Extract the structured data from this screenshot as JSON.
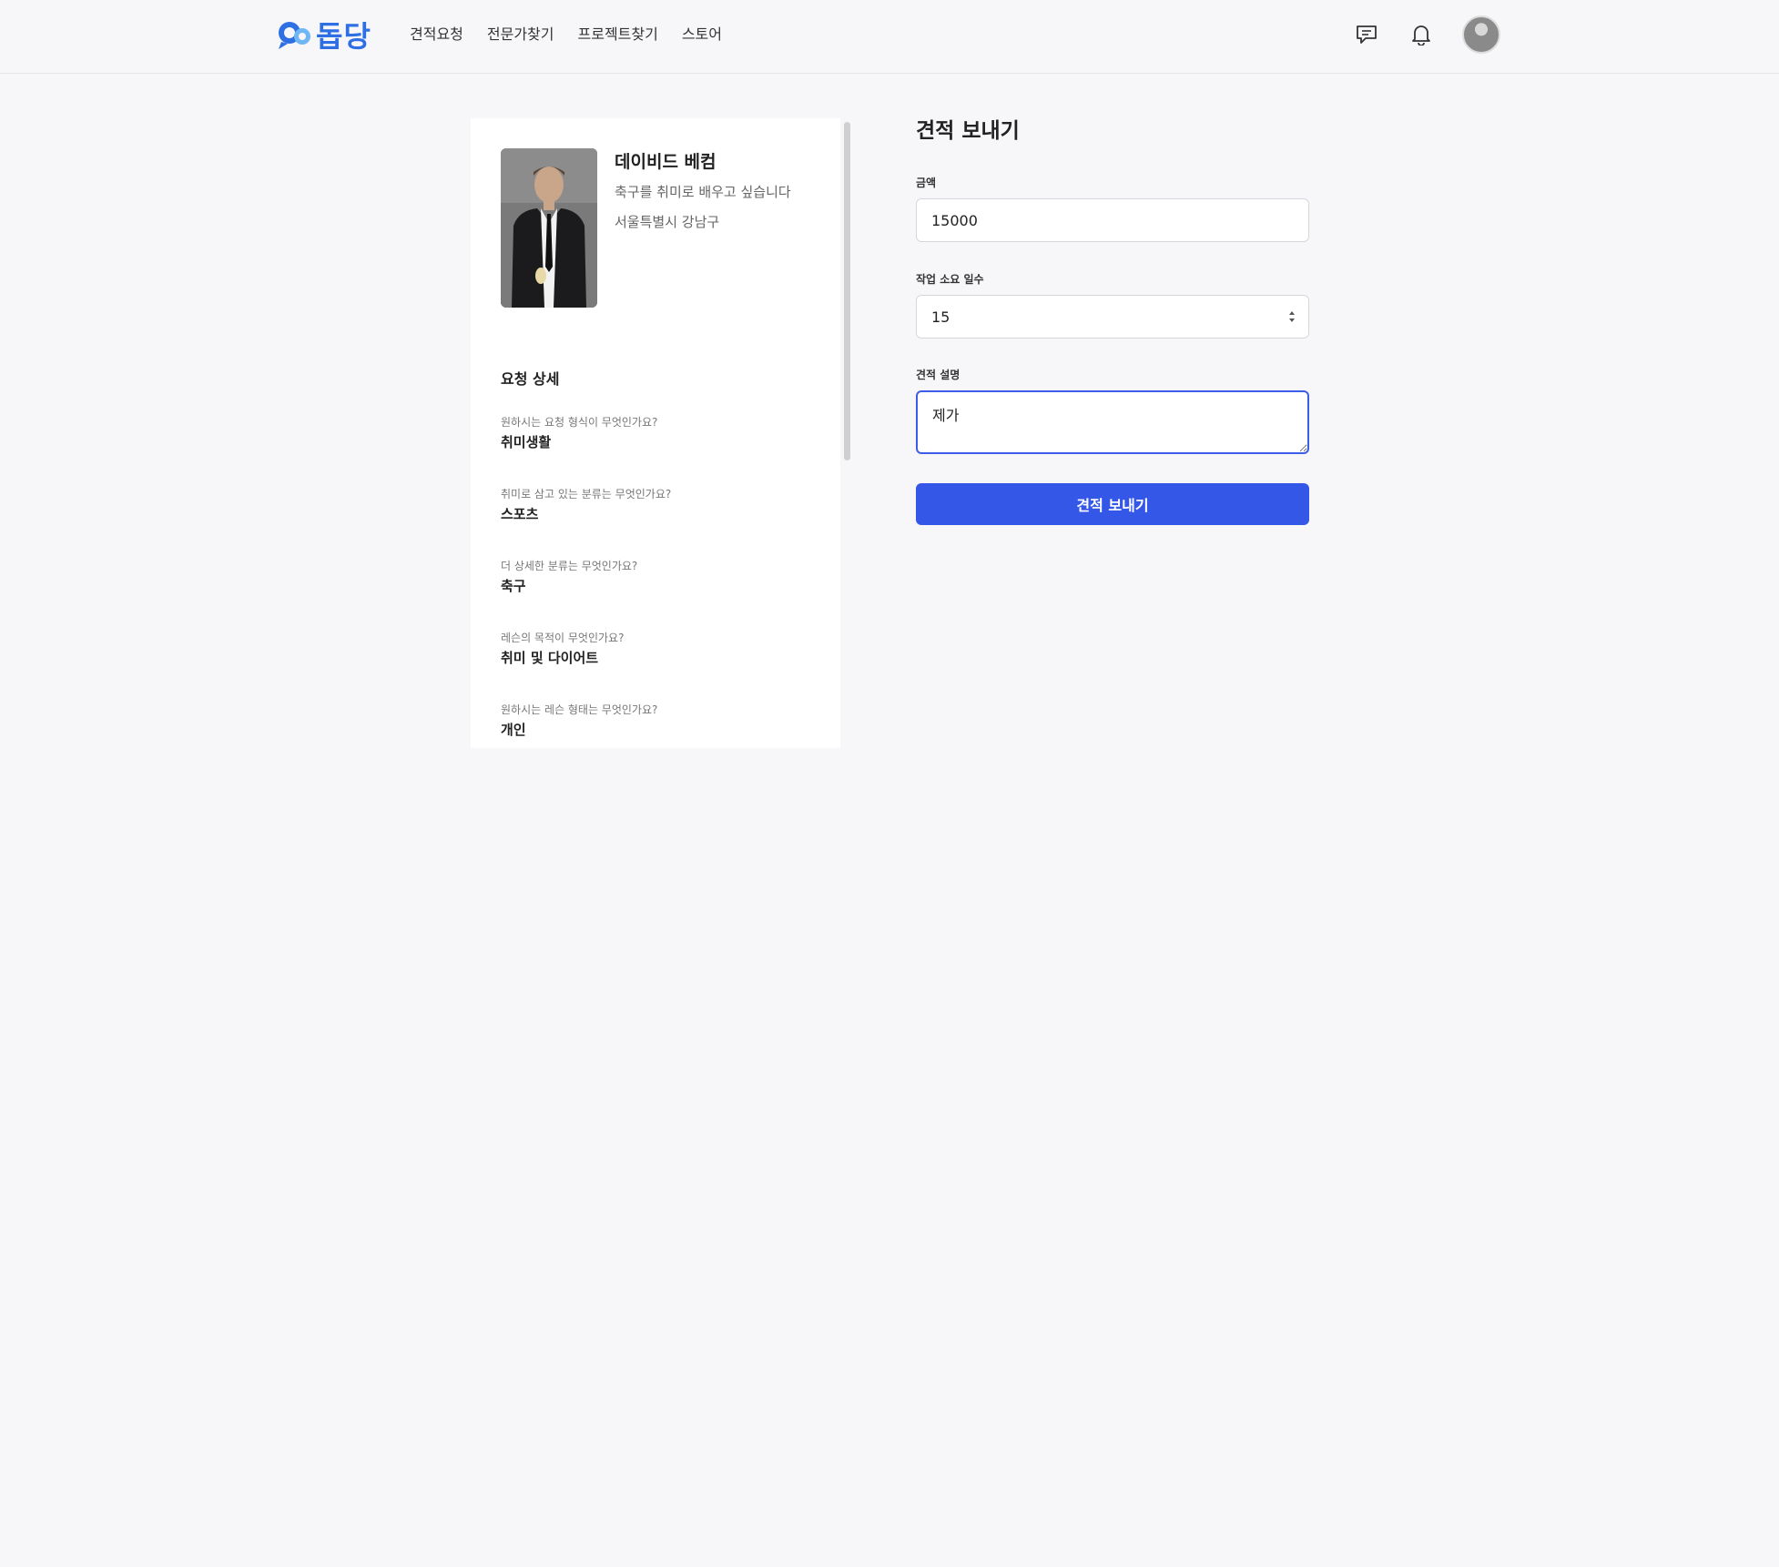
{
  "header": {
    "logo_text": "돕당",
    "nav": [
      {
        "label": "견적요청"
      },
      {
        "label": "전문가찾기"
      },
      {
        "label": "프로젝트찾기"
      },
      {
        "label": "스토어"
      }
    ],
    "icons": [
      "chat-icon",
      "bell-icon",
      "avatar"
    ]
  },
  "profile": {
    "name": "데이비드 베컴",
    "bio": "축구를 취미로 배우고 싶습니다",
    "location": "서울특별시 강남구"
  },
  "request_details": {
    "title": "요청 상세",
    "items": [
      {
        "question": "원하시는 요청 형식이 무엇인가요?",
        "answer": "취미생활"
      },
      {
        "question": "취미로 삼고 있는 분류는 무엇인가요?",
        "answer": "스포츠"
      },
      {
        "question": "더 상세한 분류는 무엇인가요?",
        "answer": "축구"
      },
      {
        "question": "레슨의 목적이 무엇인가요?",
        "answer": "취미 및 다이어트"
      },
      {
        "question": "원하시는 레슨 형태는 무엇인가요?",
        "answer": "개인"
      }
    ]
  },
  "quote_form": {
    "title": "견적 보내기",
    "amount_label": "금액",
    "amount_value": "15000",
    "days_label": "작업 소요 일수",
    "days_value": "15",
    "description_label": "견적 설명",
    "description_value": "제가",
    "submit_label": "견적 보내기"
  },
  "colors": {
    "brand": "#2f6fe4",
    "primary_button": "#3557e8",
    "background": "#f7f7fa"
  }
}
